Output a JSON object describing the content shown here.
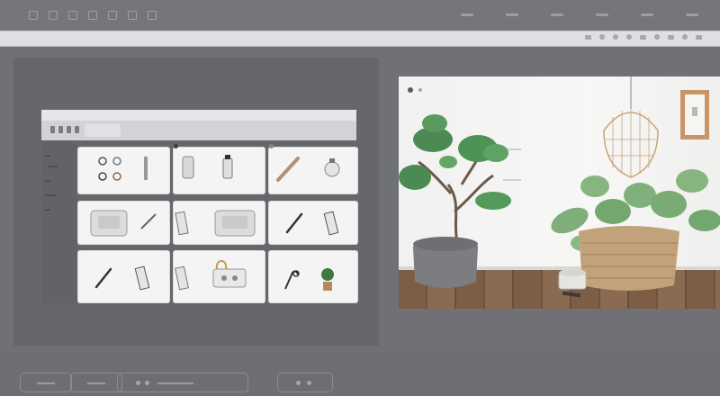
{
  "window": {
    "address_text": "",
    "app_title": ""
  },
  "toolbar": {
    "icons": [
      "back-icon",
      "forward-icon",
      "refresh-icon",
      "bookmark-icon",
      "download-icon",
      "menu-icon",
      "more-icon"
    ]
  },
  "left_panel": {
    "grid_rows": 3,
    "grid_cols": 3,
    "items": [
      "eyelet-set",
      "cup-item",
      "bottle-item",
      "bottle-item-2",
      "spatula-item",
      "kettlebell-item",
      "box-item",
      "box-item-2",
      "knife-item",
      "knife-item-2",
      "cable-item",
      "plant-item"
    ]
  },
  "right_panel": {
    "scene": "interior-plants",
    "objects": [
      "bonsai-plant",
      "rattan-pendant-lamp",
      "framed-picture",
      "potted-monstera",
      "woven-basket",
      "grey-planter"
    ]
  },
  "bottom_bar": {
    "tabs": 4
  }
}
